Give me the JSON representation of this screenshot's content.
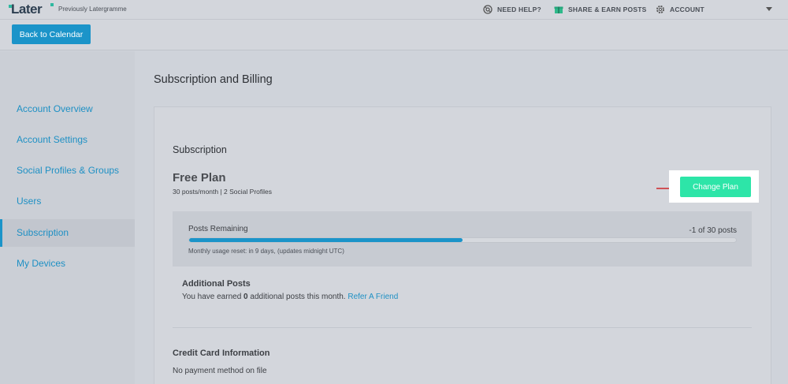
{
  "header": {
    "logo_text": "Later",
    "logo_subtitle": "Previously Latergramme",
    "nav": [
      {
        "label": "NEED HELP?",
        "icon": "help-icon"
      },
      {
        "label": "SHARE & EARN POSTS",
        "icon": "gift-icon"
      },
      {
        "label": "ACCOUNT",
        "icon": "gear-icon"
      }
    ]
  },
  "subbar": {
    "back_label": "Back to Calendar"
  },
  "sidebar": {
    "items": [
      {
        "label": "Account Overview",
        "active": false
      },
      {
        "label": "Account Settings",
        "active": false
      },
      {
        "label": "Social Profiles & Groups",
        "active": false
      },
      {
        "label": "Users",
        "active": false
      },
      {
        "label": "Subscription",
        "active": true
      },
      {
        "label": "My Devices",
        "active": false
      }
    ]
  },
  "main": {
    "page_title": "Subscription and Billing",
    "subscription": {
      "section_title": "Subscription",
      "plan_name": "Free Plan",
      "plan_desc": "30 posts/month | 2 Social Profiles",
      "change_plan_label": "Change Plan"
    },
    "usage": {
      "label": "Posts Remaining",
      "count_text": "-1 of 30 posts",
      "progress_fraction": 0.5,
      "note": "Monthly usage reset: in 9 days, (updates midnight UTC)"
    },
    "additional": {
      "title": "Additional Posts",
      "text_before": "You have earned ",
      "earned_count": "0",
      "text_after": " additional posts this month. ",
      "link_label": "Refer A Friend"
    },
    "credit_card": {
      "title": "Credit Card Information",
      "text": "No payment method on file"
    }
  },
  "colors": {
    "accent_blue": "#1b94c9",
    "change_plan_green": "#2de5a8",
    "arrow_red": "#d0262b"
  }
}
